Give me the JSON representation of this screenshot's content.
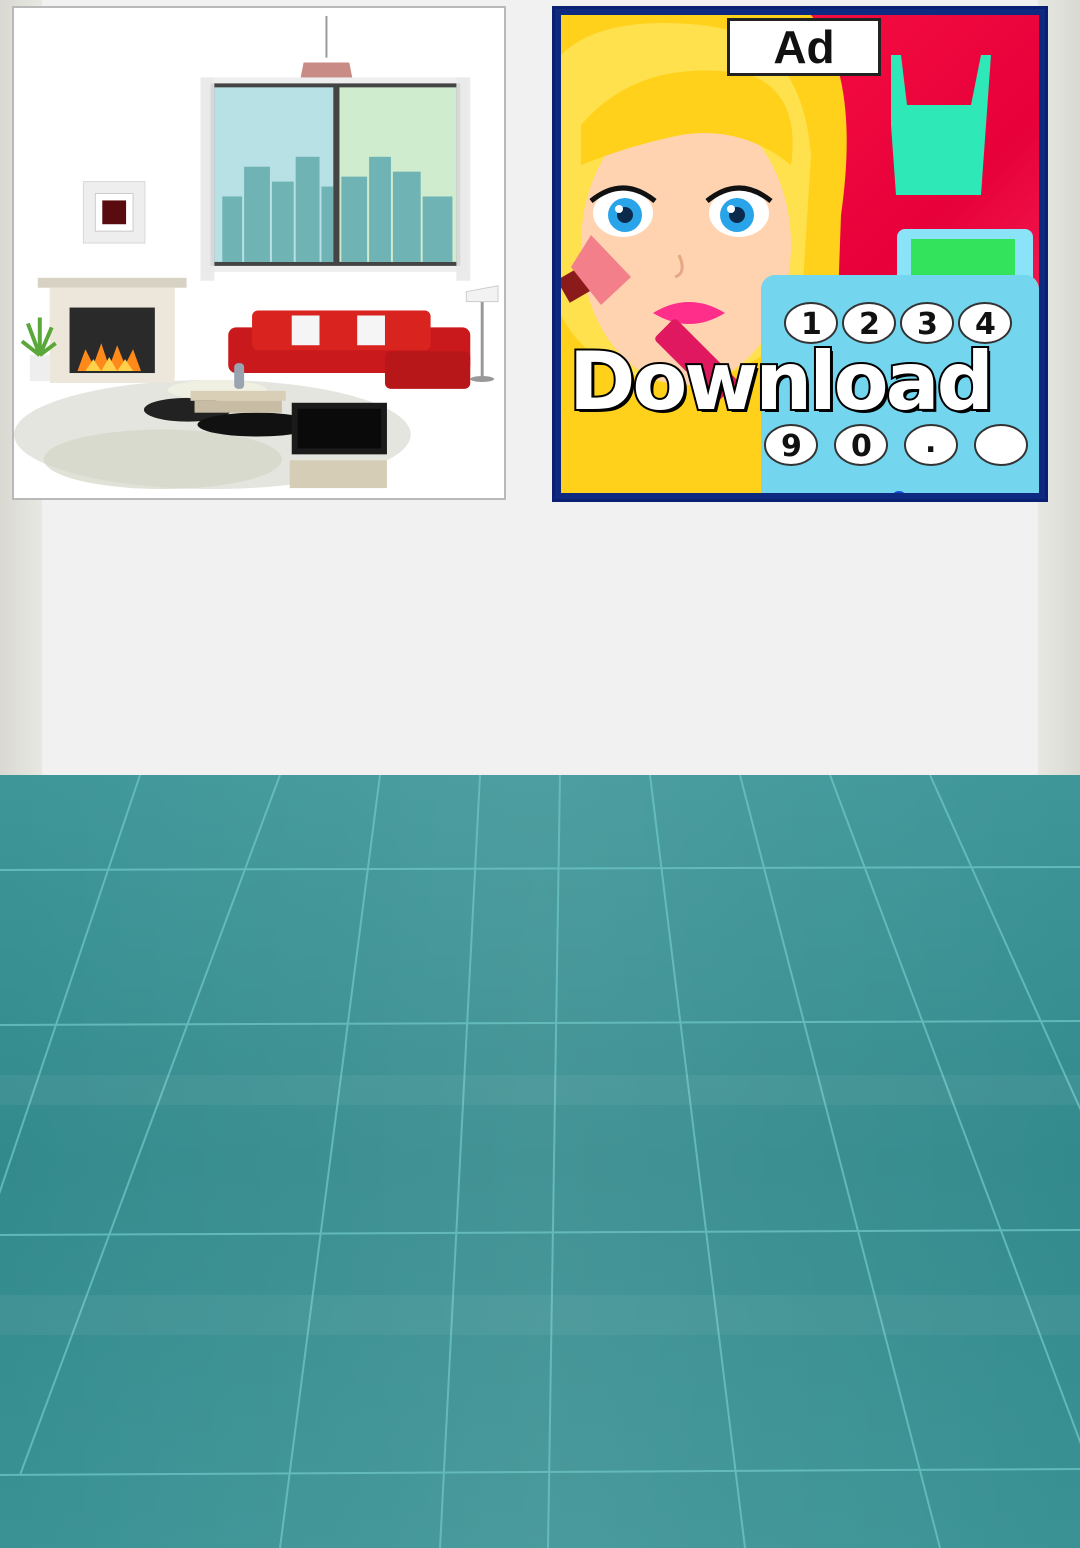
{
  "room_thumbnail": {
    "description_name": "living-room"
  },
  "ad": {
    "tag_label": "Ad",
    "cta_label": "Download",
    "register_keys": [
      "1",
      "2",
      "3",
      "4",
      "9",
      "0",
      "."
    ],
    "colors": {
      "background": "#ff1744",
      "frame": "#0d2a80",
      "register": "#6fd6f0",
      "apron": "#2ee8b8"
    }
  },
  "floor": {
    "color": "#3f9a9c"
  }
}
